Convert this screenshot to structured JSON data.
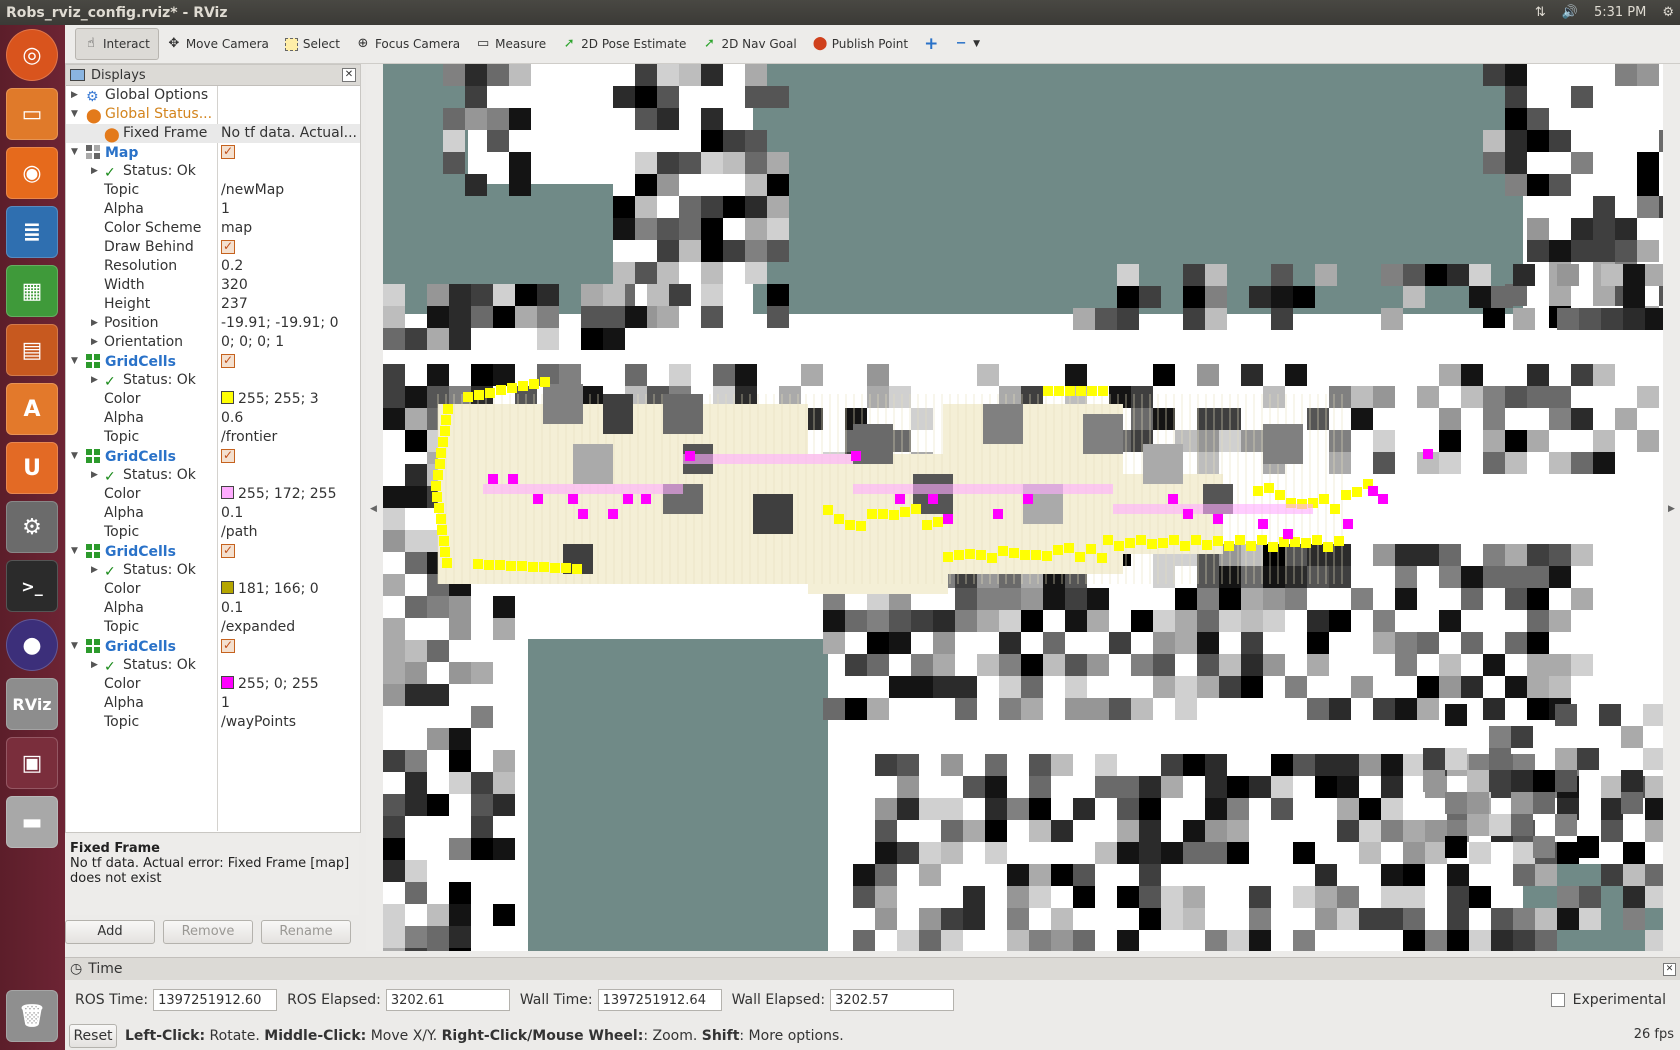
{
  "window": {
    "title": "Robs_rviz_config.rviz* - RViz"
  },
  "panel": {
    "clock": "5:31 PM"
  },
  "toolbar": {
    "tools": [
      "Interact",
      "Move Camera",
      "Select",
      "Focus Camera",
      "Measure",
      "2D Pose Estimate",
      "2D Nav Goal",
      "Publish Point"
    ]
  },
  "displays": {
    "header": "Displays",
    "global_options": "Global Options",
    "global_status": "Global Status...",
    "fixed_frame_label": "Fixed Frame",
    "fixed_frame_value": "No tf data.  Actual...",
    "map": {
      "name": "Map",
      "status": "Status: Ok",
      "props": [
        {
          "k": "Topic",
          "v": "/newMap"
        },
        {
          "k": "Alpha",
          "v": "1"
        },
        {
          "k": "Color Scheme",
          "v": "map"
        },
        {
          "k": "Draw Behind",
          "v": ""
        },
        {
          "k": "Resolution",
          "v": "0.2"
        },
        {
          "k": "Width",
          "v": "320"
        },
        {
          "k": "Height",
          "v": "237"
        },
        {
          "k": "Position",
          "v": "-19.91; -19.91; 0"
        },
        {
          "k": "Orientation",
          "v": "0; 0; 0; 1"
        }
      ]
    },
    "grids": [
      {
        "name": "GridCells",
        "status": "Status: Ok",
        "color_label": "Color",
        "color": "255; 255; 3",
        "swatch": "#ffff03",
        "alpha_label": "Alpha",
        "alpha": "0.6",
        "topic_label": "Topic",
        "topic": "/frontier"
      },
      {
        "name": "GridCells",
        "status": "Status: Ok",
        "color_label": "Color",
        "color": "255; 172; 255",
        "swatch": "#ffacff",
        "alpha_label": "Alpha",
        "alpha": "0.1",
        "topic_label": "Topic",
        "topic": "/path"
      },
      {
        "name": "GridCells",
        "status": "Status: Ok",
        "color_label": "Color",
        "color": "181; 166; 0",
        "swatch": "#b5a600",
        "alpha_label": "Alpha",
        "alpha": "0.1",
        "topic_label": "Topic",
        "topic": "/expanded"
      },
      {
        "name": "GridCells",
        "status": "Status: Ok",
        "color_label": "Color",
        "color": "255; 0; 255",
        "swatch": "#ff00ff",
        "alpha_label": "Alpha",
        "alpha": "1",
        "topic_label": "Topic",
        "topic": "/wayPoints"
      }
    ]
  },
  "help": {
    "title": "Fixed Frame",
    "text": "No tf data.  Actual error: Fixed Frame [map] does not exist"
  },
  "buttons": {
    "add": "Add",
    "remove": "Remove",
    "rename": "Rename"
  },
  "time": {
    "header": "Time",
    "ros_time_label": "ROS Time:",
    "ros_time": "1397251912.60",
    "ros_elapsed_label": "ROS Elapsed:",
    "ros_elapsed": "3202.61",
    "wall_time_label": "Wall Time:",
    "wall_time": "1397251912.64",
    "wall_elapsed_label": "Wall Elapsed:",
    "wall_elapsed": "3202.57",
    "experimental": "Experimental"
  },
  "status": {
    "reset": "Reset",
    "k1": "Left-Click:",
    "v1": " Rotate. ",
    "k2": "Middle-Click:",
    "v2": " Move X/Y. ",
    "k3": "Right-Click/Mouse Wheel:",
    "v3": ": Zoom. ",
    "k4": "Shift",
    "v4": ": More options.",
    "fps": "26 fps"
  },
  "colors": {
    "frontier": "#ffff03",
    "path": "#ffacff",
    "waypoints": "#ff00ff",
    "expanded": "#b5a600",
    "unknown": "#708a87"
  }
}
